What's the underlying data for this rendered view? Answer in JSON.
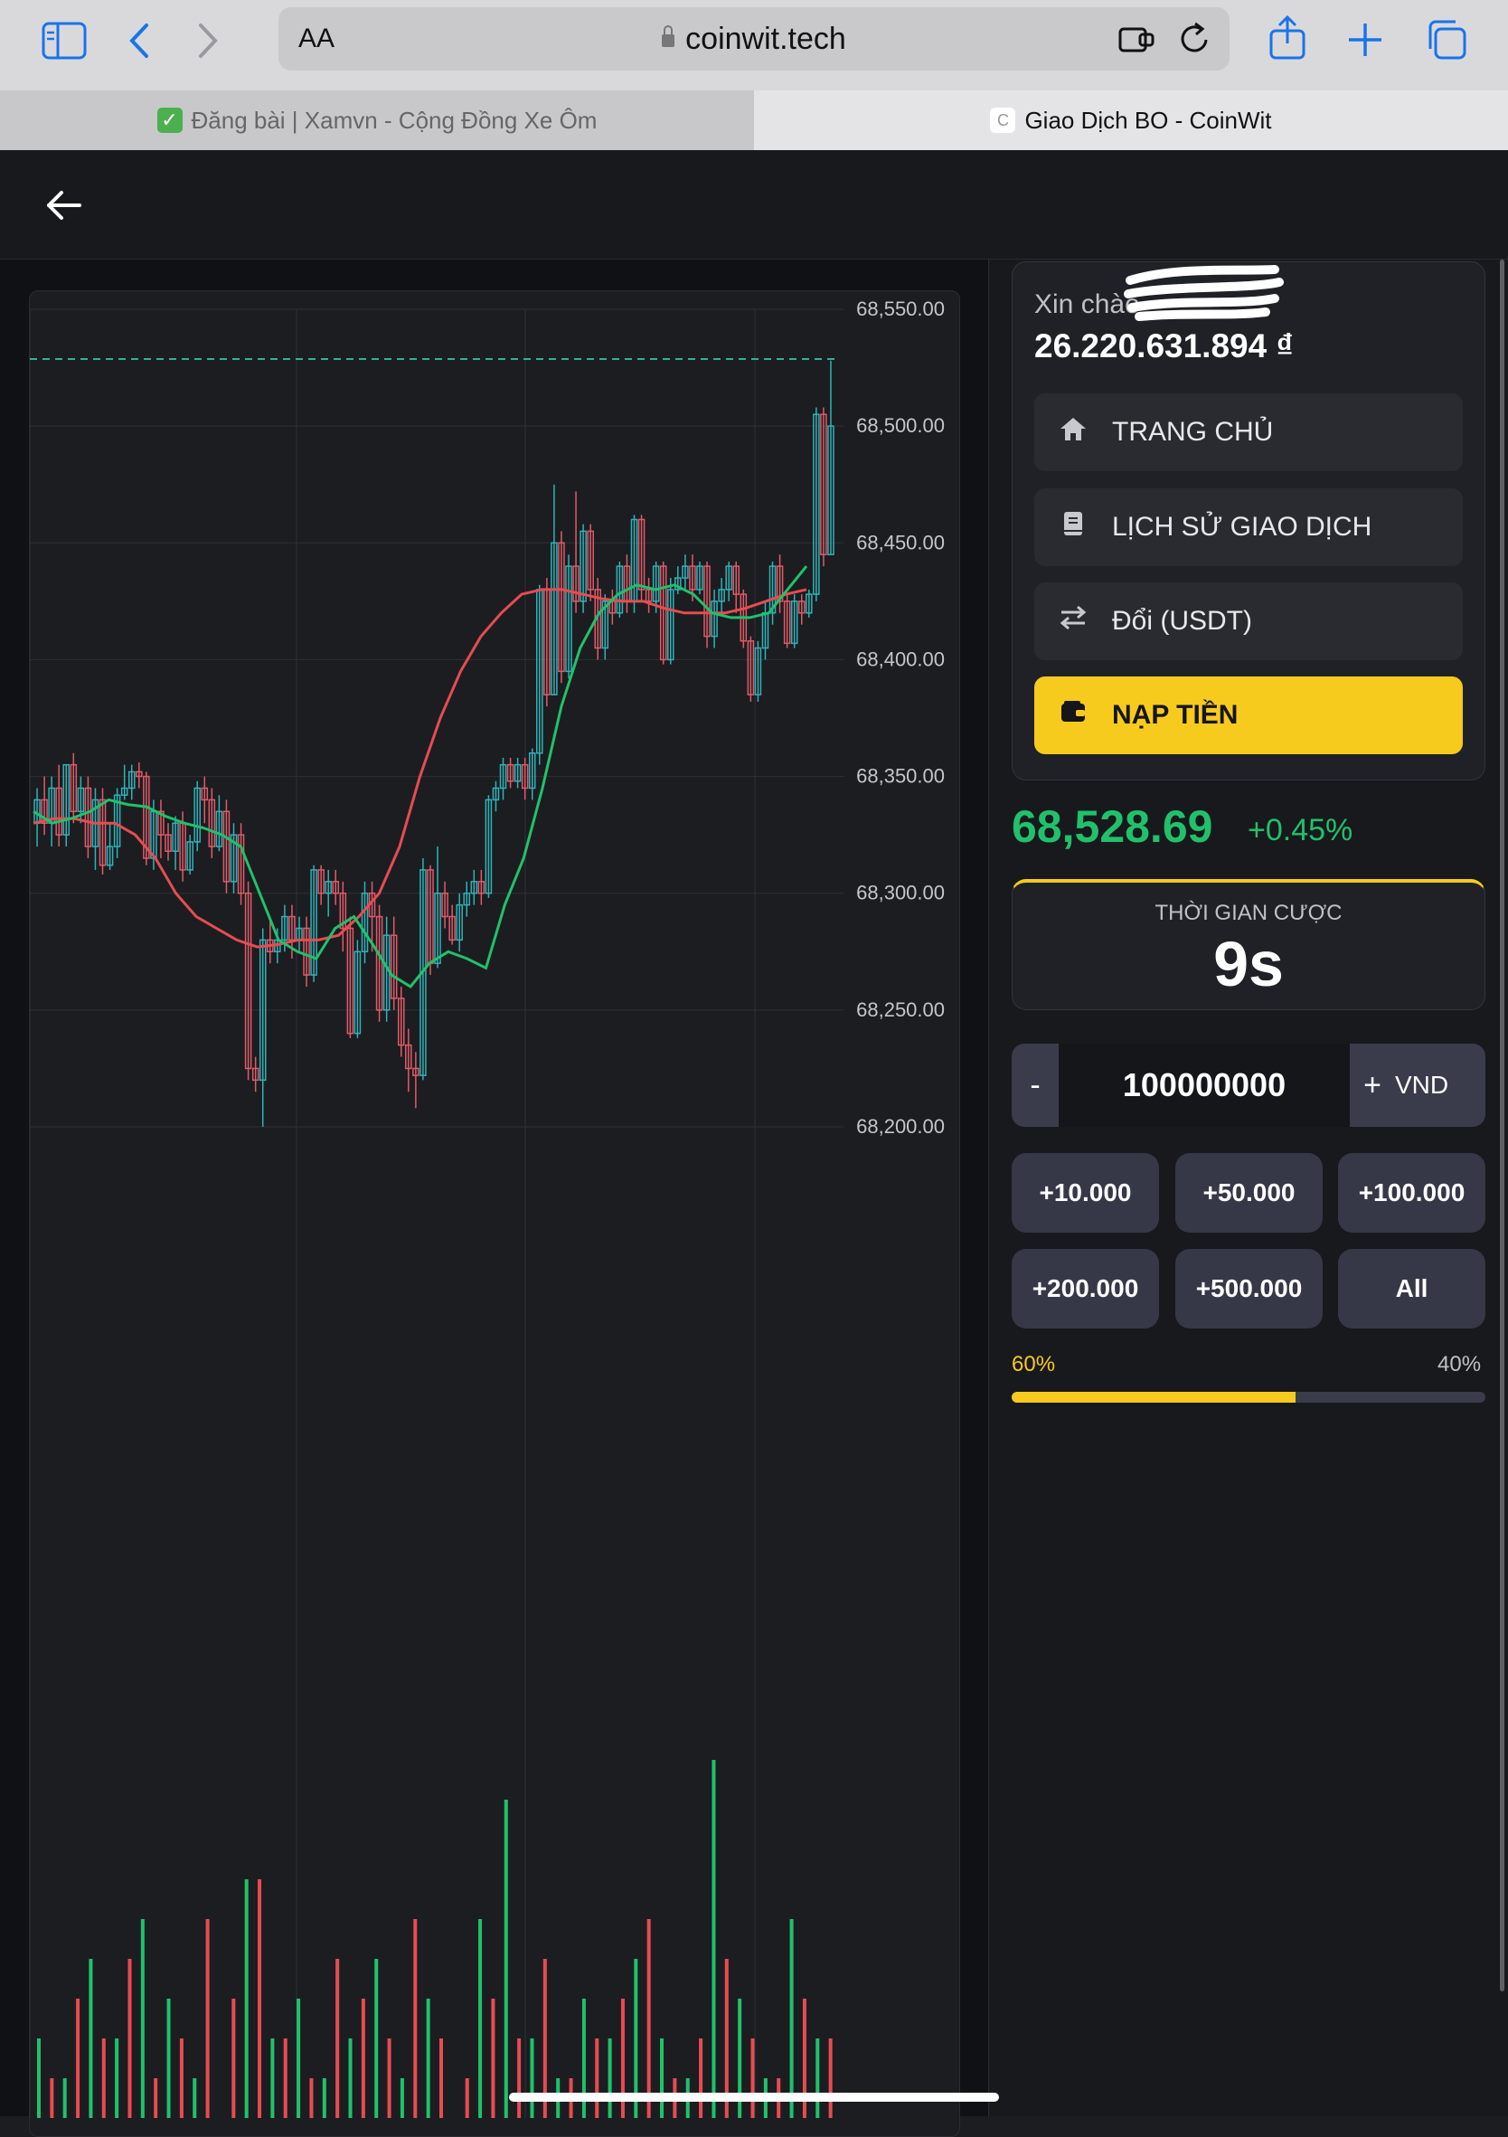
{
  "browser": {
    "text_size_label": "AA",
    "url": "coinwit.tech",
    "tabs": [
      {
        "title": "Đăng bài | Xamvn - Cộng Đồng Xe Ôm",
        "active": false
      },
      {
        "title": "Giao Dịch BO - CoinWit",
        "active": true
      }
    ],
    "icons": [
      "sidebar-icon",
      "back-icon",
      "forward-icon",
      "lock-icon",
      "extension-icon",
      "reload-icon",
      "share-icon",
      "new-tab-icon",
      "tabs-overview-icon"
    ]
  },
  "app": {
    "back_icon": "arrow-left-icon"
  },
  "account": {
    "greeting": "Xin chào",
    "balance": "26.220.631.894 ₫"
  },
  "menu": [
    {
      "label": "TRANG CHỦ",
      "icon": "home-icon"
    },
    {
      "label": "LỊCH SỬ GIAO DỊCH",
      "icon": "book-icon"
    },
    {
      "label": "Đổi (USDT)",
      "icon": "swap-icon"
    },
    {
      "label": "NẠP TIỀN",
      "icon": "wallet-icon"
    }
  ],
  "ticker": {
    "price": "68,528.69",
    "change": "+0.45%"
  },
  "timer": {
    "label": "THỜI GIAN CƯỢC",
    "value": "9s"
  },
  "amount": {
    "minus": "-",
    "value": "100000000",
    "plus": "+",
    "currency": "VND"
  },
  "quick_amounts": [
    "+10.000",
    "+50.000",
    "+100.000",
    "+200.000",
    "+500.000",
    "All"
  ],
  "ratio": {
    "left_label": "60%",
    "right_label": "40%",
    "left_fraction": 0.6
  },
  "colors": {
    "up": "#21c16b",
    "down": "#e64c52",
    "accent": "#f7ca1e",
    "candle_up": "#2fb3b8",
    "candle_down": "#e15a68"
  },
  "chart_data": {
    "type": "candlestick",
    "y_ticks": [
      "68,550.00",
      "68,500.00",
      "68,450.00",
      "68,400.00",
      "68,350.00",
      "68,300.00",
      "68,250.00",
      "68,200.00"
    ],
    "ylim": [
      68180,
      68556
    ],
    "current_price_line": 68528.69,
    "candles": [
      [
        68330,
        68340,
        68345,
        68320
      ],
      [
        68340,
        68330,
        68350,
        68325
      ],
      [
        68330,
        68345,
        68350,
        68320
      ],
      [
        68345,
        68325,
        68355,
        68320
      ],
      [
        68325,
        68355,
        68355,
        68320
      ],
      [
        68355,
        68335,
        68360,
        68330
      ],
      [
        68335,
        68345,
        68350,
        68330
      ],
      [
        68345,
        68320,
        68350,
        68315
      ],
      [
        68320,
        68340,
        68345,
        68310
      ],
      [
        68340,
        68312,
        68345,
        68308
      ],
      [
        68312,
        68320,
        68330,
        68310
      ],
      [
        68320,
        68342,
        68345,
        68315
      ],
      [
        68342,
        68345,
        68355,
        68340
      ],
      [
        68345,
        68352,
        68355,
        68340
      ],
      [
        68352,
        68350,
        68356,
        68345
      ],
      [
        68350,
        68315,
        68352,
        68312
      ],
      [
        68315,
        68335,
        68340,
        68310
      ],
      [
        68335,
        68325,
        68340,
        68315
      ],
      [
        68325,
        68318,
        68330,
        68314
      ],
      [
        68318,
        68330,
        68333,
        68310
      ],
      [
        68330,
        68310,
        68335,
        68305
      ],
      [
        68310,
        68322,
        68325,
        68308
      ],
      [
        68322,
        68345,
        68348,
        68318
      ],
      [
        68345,
        68340,
        68350,
        68330
      ],
      [
        68340,
        68320,
        68345,
        68315
      ],
      [
        68320,
        68335,
        68342,
        68318
      ],
      [
        68335,
        68305,
        68340,
        68300
      ],
      [
        68305,
        68325,
        68330,
        68300
      ],
      [
        68325,
        68300,
        68330,
        68295
      ],
      [
        68300,
        68225,
        68305,
        68220
      ],
      [
        68225,
        68220,
        68230,
        68215
      ],
      [
        68220,
        68280,
        68285,
        68200
      ],
      [
        68280,
        68275,
        68290,
        68270
      ],
      [
        68275,
        68280,
        68285,
        68270
      ],
      [
        68280,
        68290,
        68295,
        68275
      ],
      [
        68290,
        68280,
        68295,
        68272
      ],
      [
        68280,
        68285,
        68290,
        68275
      ],
      [
        68285,
        68265,
        68290,
        68260
      ],
      [
        68265,
        68310,
        68312,
        68262
      ],
      [
        68310,
        68300,
        68312,
        68295
      ],
      [
        68300,
        68305,
        68310,
        68290
      ],
      [
        68305,
        68300,
        68310,
        68295
      ],
      [
        68300,
        68285,
        68305,
        68275
      ],
      [
        68285,
        68240,
        68290,
        68238
      ],
      [
        68240,
        68275,
        68280,
        68238
      ],
      [
        68275,
        68300,
        68305,
        68270
      ],
      [
        68300,
        68290,
        68305,
        68275
      ],
      [
        68290,
        68250,
        68295,
        68245
      ],
      [
        68250,
        68282,
        68290,
        68245
      ],
      [
        68282,
        68255,
        68290,
        68250
      ],
      [
        68255,
        68235,
        68260,
        68230
      ],
      [
        68235,
        68225,
        68242,
        68215
      ],
      [
        68225,
        68222,
        68232,
        68208
      ],
      [
        68222,
        68310,
        68315,
        68220
      ],
      [
        68310,
        68270,
        68312,
        68265
      ],
      [
        68270,
        68300,
        68320,
        68268
      ],
      [
        68300,
        68290,
        68305,
        68285
      ],
      [
        68290,
        68280,
        68295,
        68278
      ],
      [
        68280,
        68295,
        68300,
        68275
      ],
      [
        68295,
        68300,
        68305,
        68290
      ],
      [
        68300,
        68305,
        68310,
        68295
      ],
      [
        68305,
        68300,
        68310,
        68295
      ],
      [
        68300,
        68340,
        68342,
        68298
      ],
      [
        68340,
        68345,
        68348,
        68335
      ],
      [
        68345,
        68355,
        68358,
        68340
      ],
      [
        68355,
        68348,
        68358,
        68345
      ],
      [
        68348,
        68355,
        68358,
        68345
      ],
      [
        68355,
        68345,
        68358,
        68340
      ],
      [
        68345,
        68360,
        68362,
        68340
      ],
      [
        68360,
        68430,
        68432,
        68355
      ],
      [
        68430,
        68385,
        68435,
        68380
      ],
      [
        68385,
        68450,
        68475,
        68385
      ],
      [
        68450,
        68395,
        68455,
        68390
      ],
      [
        68395,
        68440,
        68445,
        68392
      ],
      [
        68440,
        68425,
        68472,
        68420
      ],
      [
        68425,
        68455,
        68458,
        68420
      ],
      [
        68455,
        68430,
        68458,
        68425
      ],
      [
        68430,
        68405,
        68435,
        68400
      ],
      [
        68405,
        68425,
        68428,
        68400
      ],
      [
        68425,
        68420,
        68430,
        68415
      ],
      [
        68420,
        68440,
        68442,
        68418
      ],
      [
        68440,
        68425,
        68445,
        68420
      ],
      [
        68425,
        68460,
        68462,
        68420
      ],
      [
        68460,
        68430,
        68462,
        68425
      ],
      [
        68430,
        68425,
        68435,
        68420
      ],
      [
        68425,
        68440,
        68442,
        68420
      ],
      [
        68440,
        68400,
        68442,
        68398
      ],
      [
        68400,
        68430,
        68435,
        68398
      ],
      [
        68430,
        68435,
        68440,
        68428
      ],
      [
        68435,
        68440,
        68445,
        68430
      ],
      [
        68440,
        68430,
        68445,
        68425
      ],
      [
        68430,
        68440,
        68442,
        68428
      ],
      [
        68440,
        68410,
        68442,
        68405
      ],
      [
        68410,
        68425,
        68430,
        68405
      ],
      [
        68425,
        68430,
        68435,
        68420
      ],
      [
        68430,
        68440,
        68442,
        68425
      ],
      [
        68440,
        68428,
        68442,
        68420
      ],
      [
        68428,
        68408,
        68430,
        68405
      ],
      [
        68408,
        68385,
        68410,
        68382
      ],
      [
        68385,
        68405,
        68408,
        68382
      ],
      [
        68405,
        68420,
        68425,
        68400
      ],
      [
        68420,
        68440,
        68442,
        68415
      ],
      [
        68440,
        68425,
        68445,
        68420
      ],
      [
        68425,
        68407,
        68428,
        68405
      ],
      [
        68407,
        68425,
        68428,
        68405
      ],
      [
        68425,
        68420,
        68428,
        68415
      ],
      [
        68420,
        68428,
        68430,
        68418
      ],
      [
        68428,
        68505,
        68508,
        68425
      ],
      [
        68505,
        68445,
        68508,
        68440
      ],
      [
        68445,
        68500,
        68528,
        68445
      ]
    ],
    "ma_green": [
      68335,
      68330,
      68332,
      68335,
      68340,
      68338,
      68337,
      68333,
      68330,
      68328,
      68325,
      68320,
      68300,
      68280,
      68275,
      68272,
      68285,
      68290,
      68278,
      68265,
      68260,
      68270,
      68275,
      68272,
      68268,
      68295,
      68315,
      68345,
      68380,
      68405,
      68420,
      68428,
      68432,
      68430,
      68432,
      68428,
      68420,
      68418,
      68418,
      68420,
      68430,
      68440
    ],
    "ma_red": [
      68330,
      68332,
      68332,
      68330,
      68330,
      68325,
      68315,
      68300,
      68290,
      68285,
      68280,
      68277,
      68278,
      68280,
      68280,
      68282,
      68290,
      68300,
      68320,
      68350,
      68375,
      68395,
      68410,
      68420,
      68428,
      68430,
      68430,
      68428,
      68426,
      68425,
      68425,
      68422,
      68420,
      68420,
      68420,
      68422,
      68425,
      68428,
      68430
    ],
    "volume_up": [
      2,
      1,
      4,
      2,
      5,
      3,
      1,
      0,
      6,
      2,
      3,
      1,
      2,
      4,
      1,
      3,
      0,
      5,
      8,
      2,
      1,
      3,
      2,
      4,
      2,
      1,
      9,
      3,
      1,
      5,
      2
    ],
    "volume_down": [
      1,
      3,
      2,
      4,
      1,
      2,
      5,
      3,
      6,
      2,
      1,
      4,
      3,
      2,
      5,
      2,
      1,
      3,
      2,
      4,
      1,
      2,
      3,
      5,
      1,
      2,
      4,
      2,
      1,
      3,
      2
    ]
  }
}
